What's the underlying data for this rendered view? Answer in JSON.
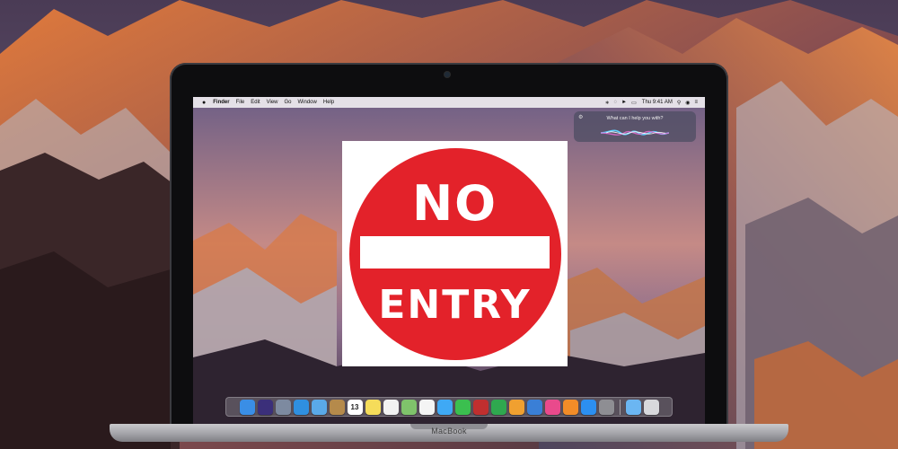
{
  "menubar": {
    "apple_icon": "apple-logo-icon",
    "app_name": "Finder",
    "items": [
      "File",
      "Edit",
      "View",
      "Go",
      "Window",
      "Help"
    ],
    "status_icons": [
      "bluetooth-icon",
      "wifi-icon",
      "volume-icon",
      "battery-icon"
    ],
    "clock": "Thu 9:41 AM"
  },
  "siri": {
    "prompt": "What can I help you with?"
  },
  "dock": {
    "apps": [
      {
        "icon": "finder-icon",
        "color": "#3a8ee6"
      },
      {
        "icon": "siri-icon",
        "color": "#3b2f7a"
      },
      {
        "icon": "launchpad-icon",
        "color": "#7d8aa0"
      },
      {
        "icon": "safari-icon",
        "color": "#2f8fe0"
      },
      {
        "icon": "mail-icon",
        "color": "#5aa9e8"
      },
      {
        "icon": "contacts-icon",
        "color": "#b58a4b"
      },
      {
        "icon": "calendar-icon",
        "color": "#ffffff",
        "label": "13"
      },
      {
        "icon": "notes-icon",
        "color": "#f5dc5a"
      },
      {
        "icon": "reminders-icon",
        "color": "#f2f2f2"
      },
      {
        "icon": "maps-icon",
        "color": "#7fc36b"
      },
      {
        "icon": "photos-icon",
        "color": "#f4f4f4"
      },
      {
        "icon": "messages-icon",
        "color": "#3fa9f5"
      },
      {
        "icon": "facetime-icon",
        "color": "#3bbf4f"
      },
      {
        "icon": "photo-booth-icon",
        "color": "#c02f2f"
      },
      {
        "icon": "numbers-icon",
        "color": "#2fa84f"
      },
      {
        "icon": "pages-icon",
        "color": "#f0a030"
      },
      {
        "icon": "keynote-icon",
        "color": "#3a7fd6"
      },
      {
        "icon": "itunes-icon",
        "color": "#e94a8c"
      },
      {
        "icon": "ibooks-icon",
        "color": "#f28c28"
      },
      {
        "icon": "app-store-icon",
        "color": "#2c8ff0"
      },
      {
        "icon": "system-preferences-icon",
        "color": "#8e8e93"
      }
    ],
    "tail": [
      {
        "icon": "downloads-folder-icon",
        "color": "#6bb6f2"
      },
      {
        "icon": "trash-icon",
        "color": "#d8d8dc"
      }
    ]
  },
  "laptop": {
    "label": "MacBook"
  },
  "sign": {
    "line1": "NO",
    "line2": "ENTRY",
    "color": "#e3222a"
  }
}
